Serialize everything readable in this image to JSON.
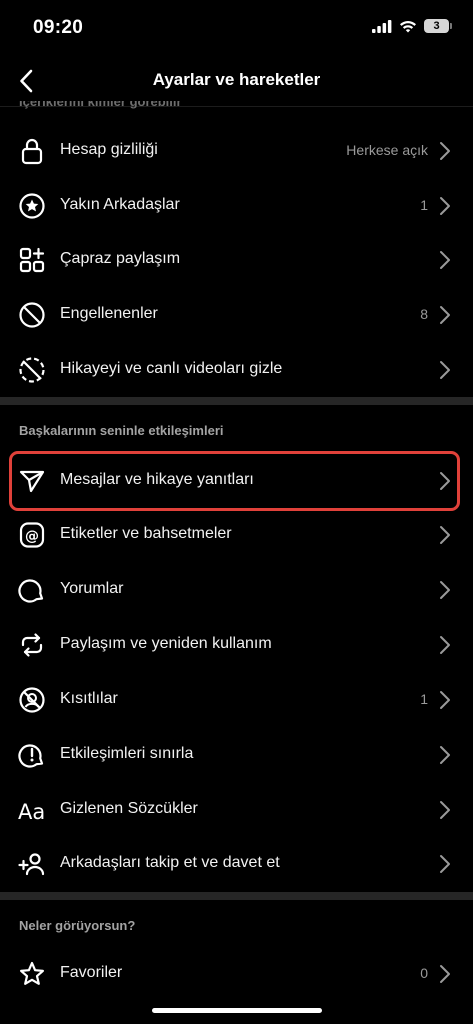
{
  "status_bar": {
    "time": "09:20",
    "battery": "3"
  },
  "nav": {
    "title": "Ayarlar ve hareketler"
  },
  "cut_section_title": "İçeriklerini kimler görebilir",
  "rows_top": [
    {
      "label": "Hesap gizliliği",
      "value": "Herkese açık"
    },
    {
      "label": "Yakın Arkadaşlar",
      "value": "1"
    },
    {
      "label": "Çapraz paylaşım",
      "value": ""
    },
    {
      "label": "Engellenenler",
      "value": "8"
    },
    {
      "label": "Hikayeyi ve canlı videoları gizle",
      "value": ""
    }
  ],
  "section_interactions": {
    "title": "Başkalarının seninle etkileşimleri",
    "items": [
      {
        "label": "Mesajlar ve hikaye yanıtları",
        "value": ""
      },
      {
        "label": "Etiketler ve bahsetmeler",
        "value": ""
      },
      {
        "label": "Yorumlar",
        "value": ""
      },
      {
        "label": "Paylaşım ve yeniden kullanım",
        "value": ""
      },
      {
        "label": "Kısıtlılar",
        "value": "1"
      },
      {
        "label": "Etkileşimleri sınırla",
        "value": ""
      },
      {
        "label": "Gizlenen Sözcükler",
        "value": ""
      },
      {
        "label": "Arkadaşları takip et ve davet et",
        "value": ""
      }
    ]
  },
  "section_seen": {
    "title": "Neler görüyorsun?",
    "items": [
      {
        "label": "Favoriler",
        "value": "0"
      }
    ]
  },
  "colors": {
    "background": "#000000",
    "highlight": "#e0413a",
    "divider": "#262626",
    "secondary_text": "#9a9a9a"
  }
}
